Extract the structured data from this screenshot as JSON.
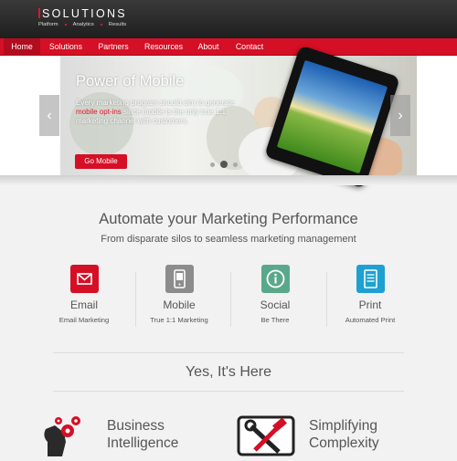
{
  "brand": {
    "name": "SOLUTIONS",
    "tagline": [
      "Platform",
      "Analytics",
      "Results"
    ],
    "accent": "#d50f25"
  },
  "nav": {
    "items": [
      {
        "label": "Home",
        "active": true
      },
      {
        "label": "Solutions",
        "active": false
      },
      {
        "label": "Partners",
        "active": false
      },
      {
        "label": "Resources",
        "active": false
      },
      {
        "label": "About",
        "active": false
      },
      {
        "label": "Contact",
        "active": false
      }
    ]
  },
  "hero": {
    "title": "Power of Mobile",
    "text_before": "Every marketing program should aim to generate ",
    "text_highlight": "mobile opt-ins",
    "text_after": " since mobile is the only true 1:1 marketing channel with customers.",
    "button_label": "Go Mobile",
    "prev_arrow": "‹",
    "next_arrow": "›",
    "slide_count": 3,
    "active_slide": 2
  },
  "intro": {
    "title": "Automate your Marketing Performance",
    "subtitle": "From disparate silos to seamless marketing management"
  },
  "features": [
    {
      "name": "Email",
      "desc": "Email Marketing",
      "icon": "envelope-icon",
      "color": "#d50f25"
    },
    {
      "name": "Mobile",
      "desc": "True 1:1 Marketing",
      "icon": "mobile-phone-icon",
      "color": "#8c8c8c"
    },
    {
      "name": "Social",
      "desc": "Be There",
      "icon": "info-icon",
      "color": "#5aa88c"
    },
    {
      "name": "Print",
      "desc": "Automated Print",
      "icon": "document-icon",
      "color": "#1ea0d2"
    }
  ],
  "yes_section": {
    "title": "Yes, It's Here"
  },
  "blocks": [
    {
      "title_line1": "Business",
      "title_line2": "Intelligence",
      "icon": "head-gears-icon"
    },
    {
      "title_line1": "Simplifying",
      "title_line2": "Complexity",
      "icon": "tools-icon"
    }
  ]
}
